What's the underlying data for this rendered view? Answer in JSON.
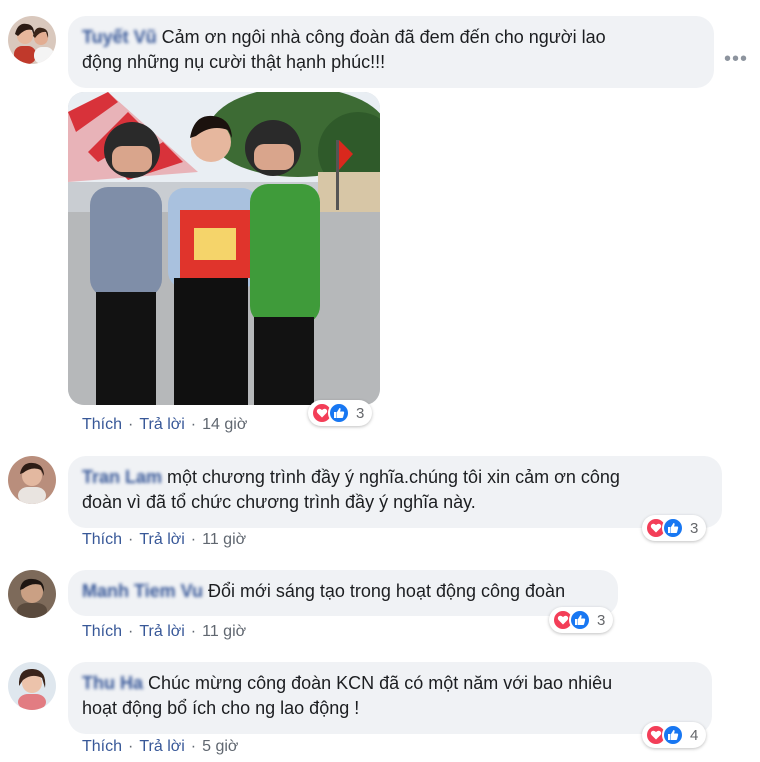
{
  "colors": {
    "author": "#385898",
    "bubble": "#f0f2f5",
    "heart": "#f33e58",
    "like": "#1877f2"
  },
  "comments": [
    {
      "author": "Tuyết Vũ",
      "text_line1": "Cảm ơn ngôi nhà công đoàn đã đem đến cho người lao",
      "text_line2": "động những nụ cười thật hạnh phúc!!!",
      "like_label": "Thích",
      "reply_label": "Trả lời",
      "time": "14 giờ",
      "reaction_count": "3",
      "reaction_icons": [
        "heart-icon",
        "like-icon"
      ],
      "has_photo": true
    },
    {
      "author": "Tran Lam",
      "text_line1": "một chương trình đầy ý nghĩa.chúng tôi xin cảm ơn công",
      "text_line2": "đoàn vì đã tổ chức chương trình đầy ý nghĩa này.",
      "like_label": "Thích",
      "reply_label": "Trả lời",
      "time": "11 giờ",
      "reaction_count": "3",
      "reaction_icons": [
        "heart-icon",
        "like-icon"
      ]
    },
    {
      "author": "Manh Tiem Vu",
      "text_line1": "Đổi mới sáng tạo trong hoạt động công đoàn",
      "like_label": "Thích",
      "reply_label": "Trả lời",
      "time": "11 giờ",
      "reaction_count": "3",
      "reaction_icons": [
        "heart-icon",
        "like-icon"
      ]
    },
    {
      "author": "Thu Ha",
      "text_line1": "Chúc mừng công đoàn KCN đã có một năm với bao nhiêu",
      "text_line2": "hoạt động bổ ích cho ng lao động !",
      "like_label": "Thích",
      "reply_label": "Trả lời",
      "time": "5 giờ",
      "reaction_count": "4",
      "reaction_icons": [
        "heart-icon",
        "like-icon"
      ]
    }
  ],
  "more_options_icon": "more-options-icon",
  "separator": "·"
}
